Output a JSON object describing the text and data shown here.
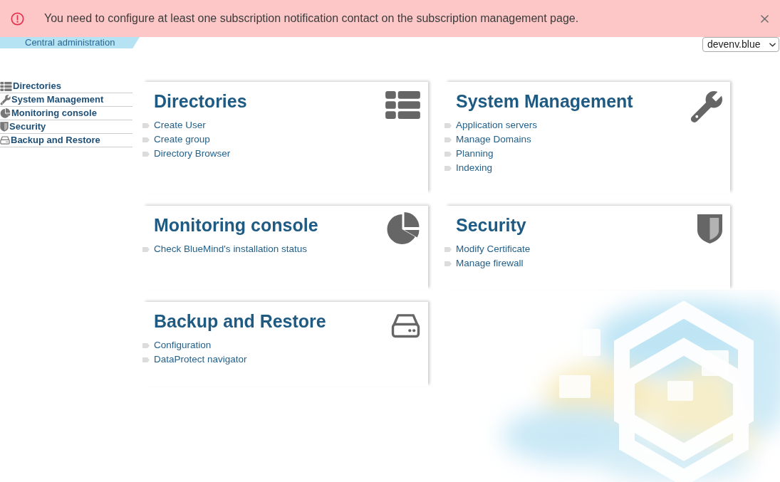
{
  "alert": {
    "kind": "error",
    "message": "You need to configure at least one subscription notification contact on the subscription management page.",
    "dismissible": true
  },
  "header": {
    "title": "Central administration",
    "domain_select": {
      "value": "devenv.blue"
    }
  },
  "sidebar": {
    "items": [
      {
        "kind": "directories",
        "label": "Directories"
      },
      {
        "kind": "system",
        "label": "System Management"
      },
      {
        "kind": "monitoring",
        "label": "Monitoring console"
      },
      {
        "kind": "security",
        "label": "Security"
      },
      {
        "kind": "backup",
        "label": "Backup and Restore"
      }
    ]
  },
  "cards": [
    {
      "kind": "directories",
      "title": "Directories",
      "links": [
        "Create User",
        "Create group",
        "Directory Browser"
      ]
    },
    {
      "kind": "system",
      "title": "System Management",
      "links": [
        "Application servers",
        "Manage Domains",
        "Planning",
        "Indexing"
      ]
    },
    {
      "kind": "monitoring",
      "title": "Monitoring console",
      "links": [
        "Check BlueMind's installation status"
      ]
    },
    {
      "kind": "security",
      "title": "Security",
      "links": [
        "Modify Certificate",
        "Manage firewall"
      ]
    },
    {
      "kind": "backup",
      "title": "Backup and Restore",
      "links": [
        "Configuration",
        "DataProtect navigator"
      ]
    }
  ]
}
